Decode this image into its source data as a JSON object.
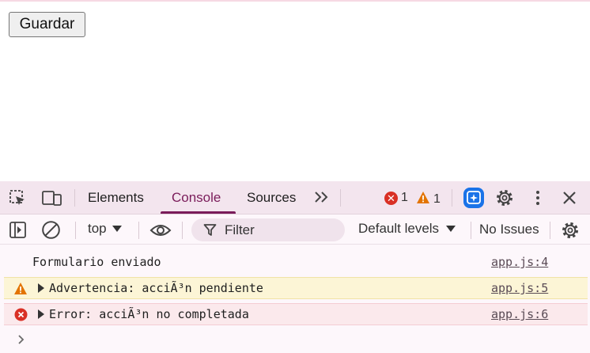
{
  "page": {
    "save_button": "Guardar"
  },
  "devtools": {
    "tabs": [
      "Elements",
      "Console",
      "Sources"
    ],
    "active_tab": "Console",
    "more_tabs_label": "»",
    "error_count": "1",
    "warning_count": "1",
    "context_selector": "top",
    "filter_placeholder": "Filter",
    "levels_label": "Default levels",
    "issues_label": "No Issues"
  },
  "console": {
    "messages": [
      {
        "level": "log",
        "text": "Formulario enviado",
        "source": "app.js:4"
      },
      {
        "level": "warning",
        "text": "Advertencia: acciÃ³n pendiente",
        "source": "app.js:5"
      },
      {
        "level": "error",
        "text": "Error: acciÃ³n no completada",
        "source": "app.js:6"
      }
    ],
    "prompt": "›"
  },
  "colors": {
    "accent": "#7a1c5a",
    "error": "#d93025",
    "warning": "#e37400",
    "ai_badge": "#1a73e8"
  }
}
